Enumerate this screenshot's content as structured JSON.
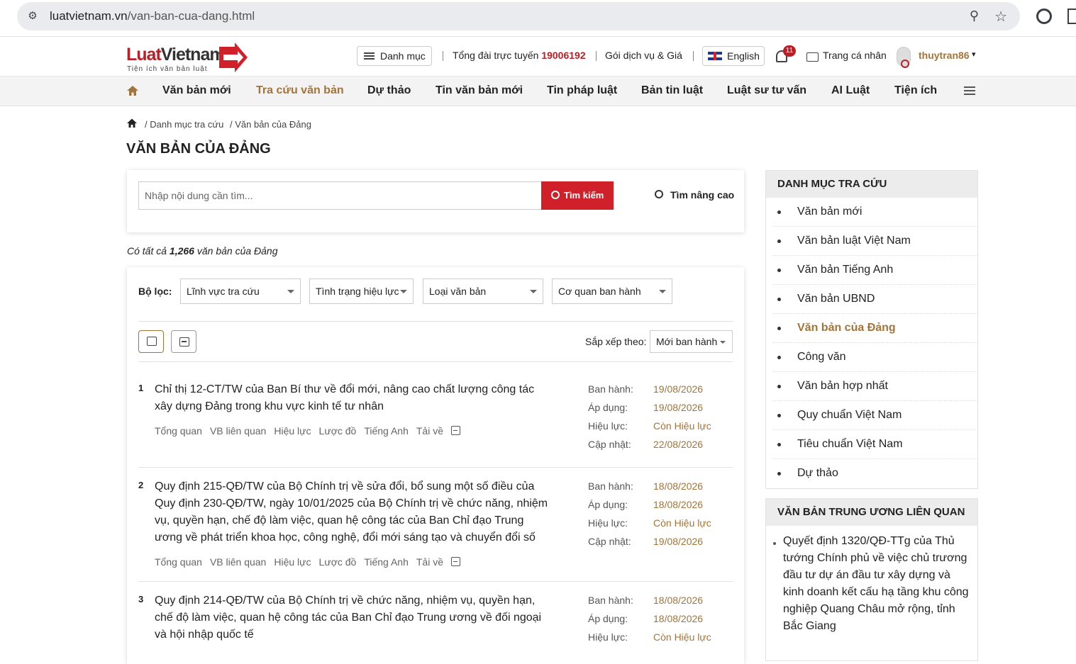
{
  "browser": {
    "url_host": "luatvietnam.vn",
    "url_path": "/van-ban-cua-dang.html"
  },
  "header": {
    "logo_text_1": "Luat",
    "logo_text_2": "Vietnam",
    "logo_tagline": "Tiện ích văn bản luật",
    "menu_label": "Danh mục",
    "hotline_label": "Tổng đài trực tuyến",
    "hotline_number": "19006192",
    "pricing_label": "Gói dịch vụ & Giá",
    "language_label": "English",
    "notification_count": "11",
    "profile_label": "Trang cá nhân",
    "username": "thuytran86",
    "username_caret": "▾"
  },
  "nav": {
    "items": [
      {
        "label": "Văn bản mới"
      },
      {
        "label": "Tra cứu văn bản",
        "active": true
      },
      {
        "label": "Dự thảo"
      },
      {
        "label": "Tin văn bản mới"
      },
      {
        "label": "Tin pháp luật"
      },
      {
        "label": "Bản tin luật"
      },
      {
        "label": "Luật sư tư vấn"
      },
      {
        "label": "AI Luật"
      },
      {
        "label": "Tiện ích"
      }
    ]
  },
  "breadcrumb": {
    "items": [
      "/ Danh mục tra cứu",
      "/ Văn bản của Đảng"
    ]
  },
  "page": {
    "title": "VĂN BẢN CỦA ĐẢNG",
    "count_prefix": "Có tất cả",
    "count_value": "1,266",
    "count_suffix": "văn bản của Đảng"
  },
  "search": {
    "placeholder": "Nhập nội dung cần tìm...",
    "button_label": "Tìm kiếm",
    "advanced_label": "Tìm nâng cao"
  },
  "filters": {
    "label": "Bộ lọc:",
    "selects": [
      "Lĩnh vực tra cứu",
      "Tình trạng hiệu lực",
      "Loại văn bản",
      "Cơ quan ban hành"
    ]
  },
  "sort": {
    "label": "Sắp xếp theo:",
    "value": "Mới ban hành"
  },
  "doc_links": [
    "Tổng quan",
    "VB liên quan",
    "Hiệu lực",
    "Lược đồ",
    "Tiếng Anh",
    "Tải về"
  ],
  "meta_labels": {
    "issued": "Ban hành:",
    "applied": "Áp dụng:",
    "status": "Hiệu lực:",
    "updated": "Cập nhật:"
  },
  "documents": [
    {
      "num": "1",
      "title_lines": [
        "Chỉ thị 12-CT/TW của Ban Bí thư về đổi mới, nâng cao chất lượng công tác",
        "xây dựng Đảng trong khu vực kinh tế tư nhân"
      ],
      "issued": "19/08/2026",
      "applied": "19/08/2026",
      "status": "Còn Hiệu lực",
      "updated": "22/08/2026"
    },
    {
      "num": "2",
      "title_lines": [
        "Quy định 215-QĐ/TW của Bộ Chính trị về sửa đổi, bổ sung một số điều của",
        "Quy định 230-QĐ/TW, ngày 10/01/2025 của Bộ Chính trị về chức năng, nhiệm",
        "vụ, quyền hạn, chế độ làm việc, quan hệ công tác của Ban Chỉ đạo Trung",
        "ương về phát triển khoa học, công nghệ, đổi mới sáng tạo và chuyển đổi số"
      ],
      "issued": "18/08/2026",
      "applied": "18/08/2026",
      "status": "Còn Hiệu lực",
      "updated": "19/08/2026"
    },
    {
      "num": "3",
      "title_lines": [
        "Quy định 214-QĐ/TW của Bộ Chính trị về chức năng, nhiệm vụ, quyền hạn,",
        "chế độ làm việc, quan hệ công tác của Ban Chỉ đạo Trung ương về đối ngoại",
        "và hội nhập quốc tế"
      ],
      "issued": "18/08/2026",
      "applied": "18/08/2026",
      "status": "Còn Hiệu lực"
    }
  ],
  "sidebar": {
    "catalog_title": "DANH MỤC TRA CỨU",
    "catalog_items": [
      {
        "label": "Văn bản mới"
      },
      {
        "label": "Văn bản luật Việt Nam"
      },
      {
        "label": "Văn bản Tiếng Anh"
      },
      {
        "label": "Văn bản UBND"
      },
      {
        "label": "Văn bản của Đảng",
        "active": true
      },
      {
        "label": "Công văn"
      },
      {
        "label": "Văn bản hợp nhất"
      },
      {
        "label": "Quy chuẩn Việt Nam"
      },
      {
        "label": "Tiêu chuẩn Việt Nam"
      },
      {
        "label": "Dự thảo"
      }
    ],
    "related_title": "VĂN BẢN TRUNG ƯƠNG LIÊN QUAN",
    "related_item_lines": [
      "Quyết định 1320/QĐ-TTg của Thủ",
      "tướng Chính phủ về việc chủ trương",
      "đầu tư dự án đầu tư xây dựng và",
      "kinh doanh kết cấu hạ tầng khu công",
      "nghiệp Quang Châu mở rộng, tỉnh",
      "Bắc Giang"
    ]
  },
  "colors": {
    "brand_red": "#d0212a",
    "accent_gold": "#a3743a"
  }
}
